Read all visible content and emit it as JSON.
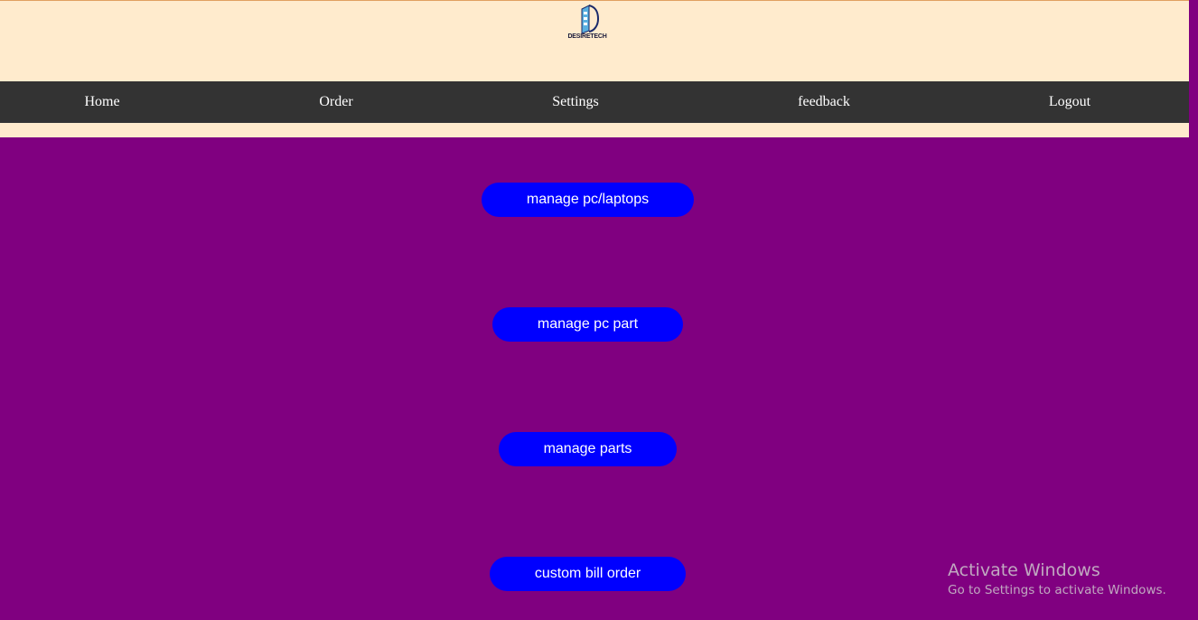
{
  "header": {
    "logo_icon": "desiretech-logo",
    "logo_text": "DESIRETECH"
  },
  "nav": {
    "items": [
      {
        "label": "Home"
      },
      {
        "label": "Order"
      },
      {
        "label": "Settings"
      },
      {
        "label": "feedback"
      },
      {
        "label": "Logout"
      }
    ]
  },
  "actions": {
    "buttons": [
      {
        "label": "manage pc/laptops"
      },
      {
        "label": "manage pc part"
      },
      {
        "label": "manage parts"
      },
      {
        "label": "custom bill order"
      }
    ]
  },
  "watermark": {
    "title": "Activate Windows",
    "subtitle": "Go to Settings to activate Windows."
  },
  "colors": {
    "page_background": "#800080",
    "header_background": "#ffebcd",
    "navbar_background": "#333333",
    "button_background": "#0000ff",
    "button_text": "#ffffff"
  }
}
